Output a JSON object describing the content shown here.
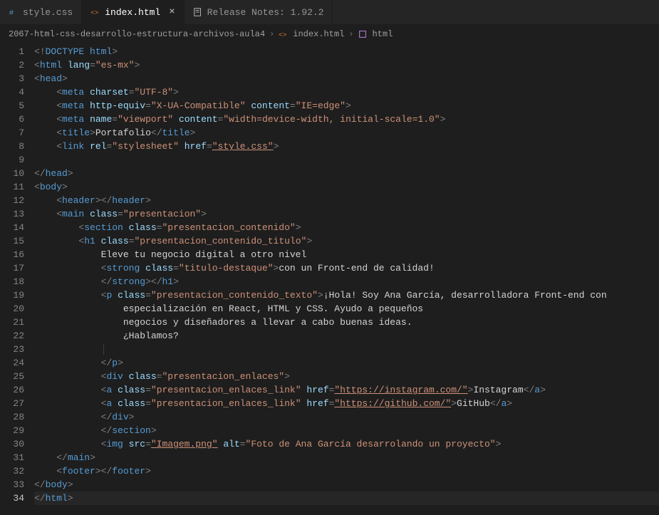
{
  "tabs": [
    {
      "label": "style.css",
      "active": false
    },
    {
      "label": "index.html",
      "active": true
    },
    {
      "label": "Release Notes: 1.92.2",
      "active": false
    }
  ],
  "breadcrumbs": {
    "project": "2067-html-css-desarrollo-estructura-archivos-aula4",
    "file": "index.html",
    "symbol": "html"
  },
  "lineCount": 34,
  "activeLine": 34,
  "code": {
    "doctype": "DOCTYPE",
    "htmlTag": "html",
    "langAttr": "lang",
    "langVal": "\"es-mx\"",
    "head": "head",
    "meta": "meta",
    "charset": "charset",
    "charsetVal": "\"UTF-8\"",
    "httpEquiv": "http-equiv",
    "httpEquivVal": "\"X-UA-Compatible\"",
    "content": "content",
    "ieEdge": "\"IE=edge\"",
    "name": "name",
    "viewport": "\"viewport\"",
    "viewportContent": "\"width=device-width, initial-scale=1.0\"",
    "title": "title",
    "titleText": "Portafolio",
    "link": "link",
    "rel": "rel",
    "stylesheet": "\"stylesheet\"",
    "href": "href",
    "styleCss": "\"style.css\"",
    "body": "body",
    "header": "header",
    "main": "main",
    "class": "class",
    "presentacion": "\"presentacion\"",
    "section": "section",
    "presentacionContenido": "\"presentacion_contenido\"",
    "h1": "h1",
    "presentacionContenidoTitulo": "\"presentacion_contenido_titulo\"",
    "h1Text": "Eleve tu negocio digital a otro nivel",
    "strong": "strong",
    "tituloDestaque": "\"titulo-destaque\"",
    "strongText": "con un Front-end de calidad!",
    "p": "p",
    "presentacionContenidoTexto": "\"presentacion_contenido_texto\"",
    "pText1": "¡Hola! Soy Ana García, desarrolladora Front-end con",
    "pText2": "especialización en React, HTML y CSS. Ayudo a pequeños",
    "pText3": "negocios y diseñadores a llevar a cabo buenas ideas.",
    "pText4": "¿Hablamos?",
    "div": "div",
    "presentacionEnlaces": "\"presentacion_enlaces\"",
    "a": "a",
    "presentacionEnlacesLink": "\"presentacion_enlaces_link\"",
    "instagramUrl": "\"https://instagram.com/\"",
    "instagramText": "Instagram",
    "githubUrl": "\"https://github.com/\"",
    "githubText": "GitHub",
    "img": "img",
    "src": "src",
    "imgSrc": "\"Imagem.png\"",
    "alt": "alt",
    "imgAlt": "\"Foto de Ana García desarrolando un proyecto\"",
    "footer": "footer"
  }
}
